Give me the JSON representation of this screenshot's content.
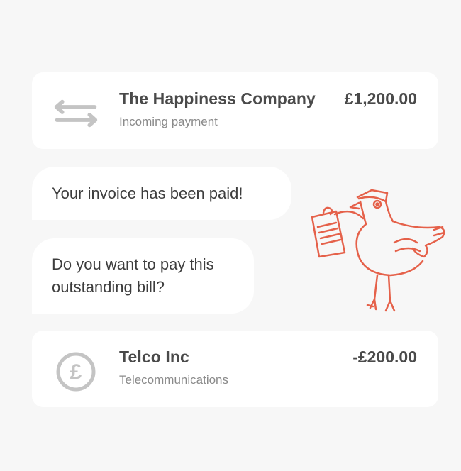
{
  "transactions": [
    {
      "name": "The Happiness Company",
      "category": "Incoming payment",
      "amount": "£1,200.00",
      "icon": "transfer-arrows-icon"
    },
    {
      "name": "Telco Inc",
      "category": "Telecommunications",
      "amount": "-£200.00",
      "icon": "pound-coin-icon"
    }
  ],
  "messages": [
    {
      "text": "Your invoice has been paid!"
    },
    {
      "text": "Do you want to pay this\noutstanding bill?"
    }
  ],
  "illustration": {
    "icon": "bird-holding-bill-icon",
    "color": "#e5614a"
  },
  "colors": {
    "background": "#f7f7f7",
    "card": "#ffffff",
    "text": "#4a4a4a",
    "muted": "#8a8a8a",
    "icon": "#c8c8c8"
  }
}
